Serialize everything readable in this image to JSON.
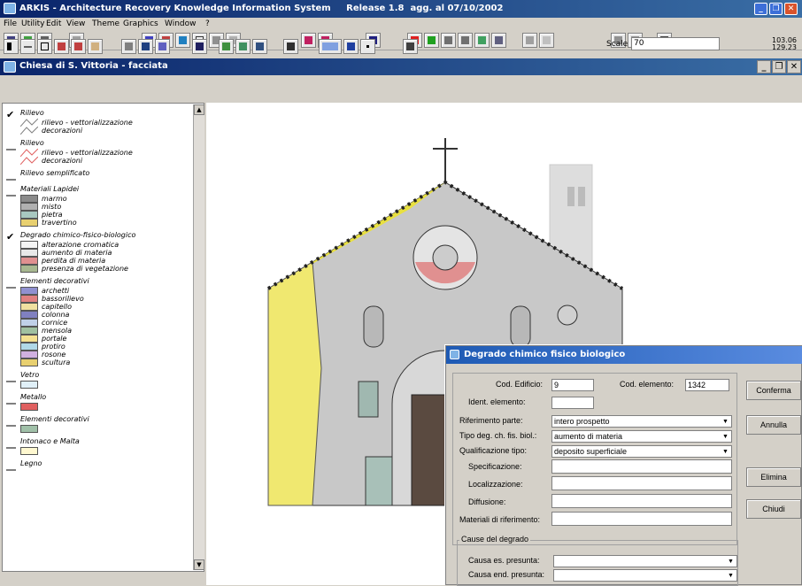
{
  "app": {
    "title": "ARKIS - Architecture Recovery Knowledge Information System     Release 1.8  agg. al 07/10/2002"
  },
  "menu": [
    "File",
    "Utility",
    "Edit",
    "View",
    "Theme",
    "Graphics",
    "Window",
    "?"
  ],
  "scale": {
    "label": "Scale 1:",
    "value": "70"
  },
  "coords": {
    "x": "103.06",
    "y": "129.23"
  },
  "document": {
    "title": "Chiesa di S. Vittoria - facciata"
  },
  "legend": {
    "groups": [
      {
        "name": "Rilievo",
        "checked": true,
        "items": [
          {
            "label": "rilievo - vettorializzazione",
            "color": "#808080",
            "line": true
          },
          {
            "label": "decorazioni",
            "color": "#808080",
            "line": true
          }
        ]
      },
      {
        "name": "Rilievo",
        "checked": false,
        "items": [
          {
            "label": "rilievo - vettorializzazione",
            "color": "#e06060",
            "line": true
          },
          {
            "label": "decorazioni",
            "color": "#e06060",
            "line": true
          }
        ]
      },
      {
        "name": "Rilievo semplificato",
        "checked": false,
        "items": []
      },
      {
        "name": "Materiali Lapidei",
        "checked": false,
        "items": [
          {
            "label": "marmo",
            "color": "#8a8a8a"
          },
          {
            "label": "misto",
            "color": "#b0b0b0"
          },
          {
            "label": "pietra",
            "color": "#a8c8c0"
          },
          {
            "label": "travertino",
            "color": "#e8d070"
          }
        ]
      },
      {
        "name": "Degrado chimico-fisico-biologico",
        "checked": true,
        "items": [
          {
            "label": "alterazione cromatica",
            "color": "#f4f4f4"
          },
          {
            "label": "aumento di materia",
            "color": "#e8e8e8"
          },
          {
            "label": "perdita di materia",
            "color": "#e09090"
          },
          {
            "label": "presenza di vegetazione",
            "color": "#a8b890"
          }
        ]
      },
      {
        "name": "Elementi decorativi",
        "checked": false,
        "items": [
          {
            "label": "archetti",
            "color": "#9090d0"
          },
          {
            "label": "bassorilievo",
            "color": "#e08080"
          },
          {
            "label": "capitello",
            "color": "#f0e0a0"
          },
          {
            "label": "colonna",
            "color": "#8080c0"
          },
          {
            "label": "cornice",
            "color": "#c0d0e8"
          },
          {
            "label": "mensola",
            "color": "#a0c0a0"
          },
          {
            "label": "portale",
            "color": "#f4e090"
          },
          {
            "label": "protiro",
            "color": "#b0d8e8"
          },
          {
            "label": "rosone",
            "color": "#d0b0e0"
          },
          {
            "label": "scultura",
            "color": "#e8d070"
          }
        ]
      },
      {
        "name": "Vetro",
        "checked": false,
        "items": [
          {
            "label": "",
            "color": "#e0f0f8"
          }
        ]
      },
      {
        "name": "Metallo",
        "checked": false,
        "items": [
          {
            "label": "",
            "color": "#e06060"
          }
        ]
      },
      {
        "name": "Elementi decorativi",
        "checked": false,
        "items": [
          {
            "label": "",
            "color": "#a0c0a8"
          }
        ]
      },
      {
        "name": "Intonaco e Malta",
        "checked": false,
        "items": [
          {
            "label": "",
            "color": "#fff8d0"
          }
        ]
      },
      {
        "name": "Legno",
        "checked": false,
        "items": []
      }
    ]
  },
  "dialog": {
    "title": "Degrado chimico fisico biologico",
    "cod_edificio_label": "Cod. Edificio:",
    "cod_edificio": "9",
    "cod_elemento_label": "Cod. elemento:",
    "cod_elemento": "1342",
    "ident_label": "Ident. elemento:",
    "ident": "",
    "rif_label": "Riferimento parte:",
    "rif": "intero prospetto",
    "tipo_label": "Tipo deg. ch. fis. biol.:",
    "tipo": "aumento di materia",
    "qual_label": "Qualificazione tipo:",
    "qual": "deposito superficiale",
    "spec_label": "Specificazione:",
    "spec": "",
    "loc_label": "Localizzazione:",
    "loc": "",
    "diff_label": "Diffusione:",
    "diff": "",
    "mat_label": "Materiali di riferimento:",
    "mat": "",
    "cause_label": "Cause del degrado",
    "causa_es_label": "Causa es. presunta:",
    "causa_es": "",
    "causa_end_label": "Causa end. presunta:",
    "causa_end": "",
    "btn_conferma": "Conferma",
    "btn_annulla": "Annulla",
    "btn_elimina": "Elimina",
    "btn_chiudi": "Chiudi"
  }
}
